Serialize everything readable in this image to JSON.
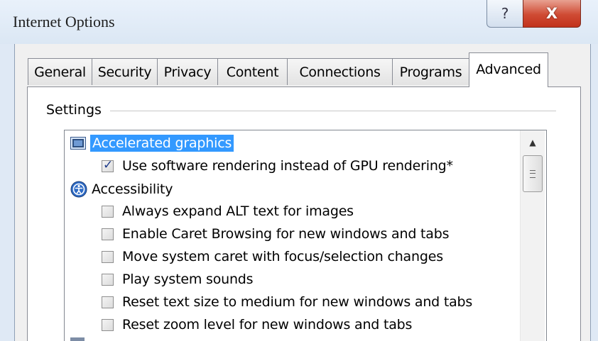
{
  "window": {
    "title": "Internet Options",
    "help_label": "?",
    "close_label": "X"
  },
  "tabs": [
    {
      "label": "General"
    },
    {
      "label": "Security"
    },
    {
      "label": "Privacy"
    },
    {
      "label": "Content"
    },
    {
      "label": "Connections"
    },
    {
      "label": "Programs"
    },
    {
      "label": "Advanced",
      "active": true
    }
  ],
  "settings": {
    "group_label": "Settings",
    "items": [
      {
        "kind": "category",
        "icon": "monitor-icon",
        "label": "Accelerated graphics",
        "selected": true
      },
      {
        "kind": "checkbox",
        "label": "Use software rendering instead of GPU rendering*",
        "checked": true
      },
      {
        "kind": "category",
        "icon": "accessibility-icon",
        "label": "Accessibility",
        "selected": false
      },
      {
        "kind": "checkbox",
        "label": "Always expand ALT text for images",
        "checked": false
      },
      {
        "kind": "checkbox",
        "label": "Enable Caret Browsing for new windows and tabs",
        "checked": false
      },
      {
        "kind": "checkbox",
        "label": "Move system caret with focus/selection changes",
        "checked": false
      },
      {
        "kind": "checkbox",
        "label": "Play system sounds",
        "checked": false
      },
      {
        "kind": "checkbox",
        "label": "Reset text size to medium for new windows and tabs",
        "checked": false
      },
      {
        "kind": "checkbox",
        "label": "Reset zoom level for new windows and tabs",
        "checked": false
      }
    ]
  },
  "colors": {
    "selection": "#3399ff",
    "close_button": "#c2321c"
  }
}
